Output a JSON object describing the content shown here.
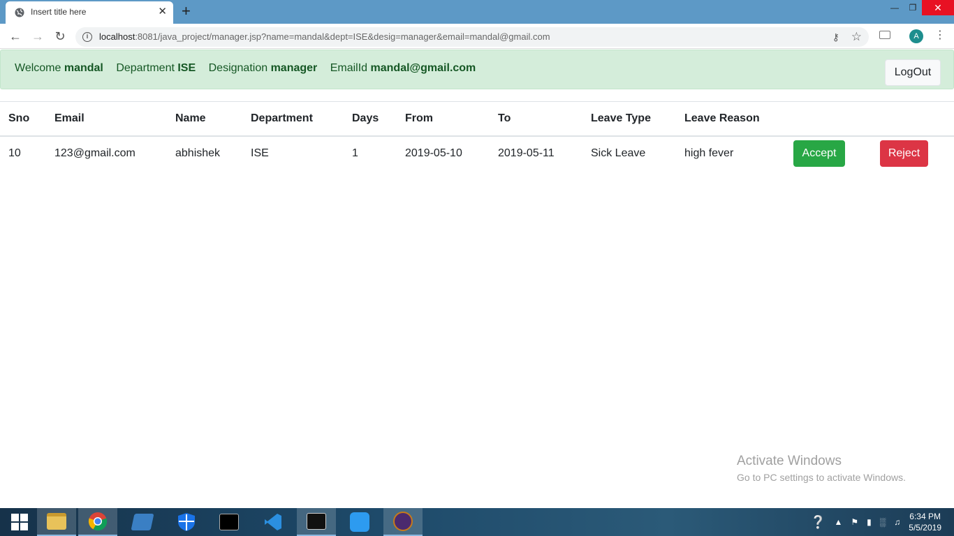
{
  "browser": {
    "tab_title": "Insert title here",
    "tab_close": "✕",
    "new_tab": "+",
    "url_host": "localhost",
    "url_rest": ":8081/java_project/manager.jsp?name=mandal&dept=ISE&desig=manager&email=mandal@gmail.com",
    "profile_initial": "A"
  },
  "header": {
    "welcome_label": "Welcome",
    "welcome_value": "mandal",
    "department_label": "Department",
    "department_value": "ISE",
    "designation_label": "Designation",
    "designation_value": "manager",
    "email_label": "EmailId",
    "email_value": "mandal@gmail.com",
    "logout_label": "LogOut"
  },
  "table": {
    "columns": [
      "Sno",
      "Email",
      "Name",
      "Department",
      "Days",
      "From",
      "To",
      "Leave Type",
      "Leave Reason"
    ],
    "rows": [
      {
        "sno": "10",
        "email": "123@gmail.com",
        "name": "abhishek",
        "department": "ISE",
        "days": "1",
        "from": "2019-05-10",
        "to": "2019-05-11",
        "leave_type": "Sick Leave",
        "leave_reason": "high fever",
        "accept_label": "Accept",
        "reject_label": "Reject"
      }
    ]
  },
  "watermark": {
    "line1": "Activate Windows",
    "line2": "Go to PC settings to activate Windows."
  },
  "taskbar": {
    "time": "6:34 PM",
    "date": "5/5/2019",
    "icons": [
      "start-icon",
      "file-explorer-icon",
      "chrome-icon",
      "app-icon",
      "defender-icon",
      "cmd-icon",
      "vscode-icon",
      "mysql-icon",
      "w-app-icon",
      "java-ee-ide-icon"
    ]
  },
  "colors": {
    "accept": "#28a745",
    "reject": "#dc3545",
    "alert_bg": "#d4edda",
    "alert_text": "#155724"
  }
}
